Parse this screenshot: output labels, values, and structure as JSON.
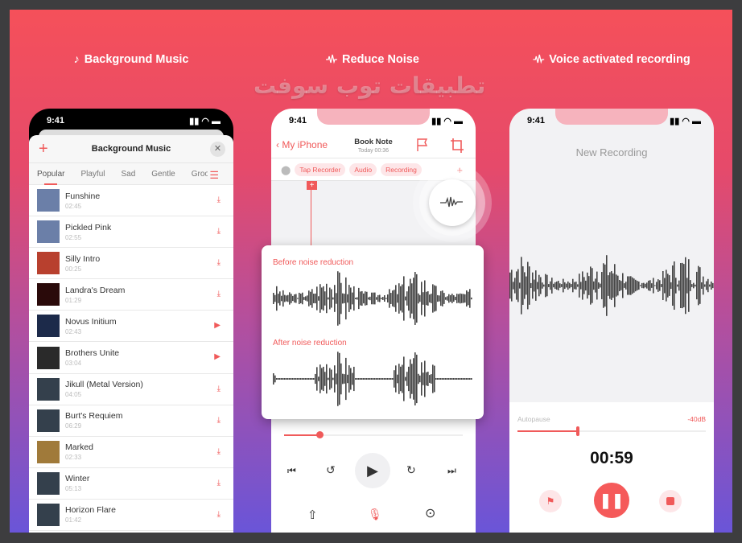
{
  "watermark": "تطبيقات توب سوفت",
  "features": [
    {
      "icon": "music-note-icon",
      "label": "Background Music"
    },
    {
      "icon": "waveform-icon",
      "label": "Reduce Noise"
    },
    {
      "icon": "waveform-icon",
      "label": "Voice activated recording"
    }
  ],
  "colors": {
    "accent": "#f05a5a",
    "bg_top": "#f5505a",
    "bg_bottom": "#6a55d8"
  },
  "status_time": "9:41",
  "music": {
    "title": "Background Music",
    "tabs": [
      "Popular",
      "Playful",
      "Sad",
      "Gentle",
      "Groovi"
    ],
    "tracks": [
      {
        "name": "Funshine",
        "duration": "02:45",
        "action": "download"
      },
      {
        "name": "Pickled Pink",
        "duration": "02:55",
        "action": "download"
      },
      {
        "name": "Silly Intro",
        "duration": "00:25",
        "action": "download"
      },
      {
        "name": "Landra's Dream",
        "duration": "01:29",
        "action": "download"
      },
      {
        "name": "Novus Initium",
        "duration": "02:43",
        "action": "play"
      },
      {
        "name": "Brothers Unite",
        "duration": "03:04",
        "action": "play"
      },
      {
        "name": "Jikull (Metal Version)",
        "duration": "04:05",
        "action": "download"
      },
      {
        "name": "Burt's Requiem",
        "duration": "06:29",
        "action": "download"
      },
      {
        "name": "Marked",
        "duration": "02:33",
        "action": "download"
      },
      {
        "name": "Winter",
        "duration": "05:13",
        "action": "download"
      },
      {
        "name": "Horizon Flare",
        "duration": "01:42",
        "action": "download"
      }
    ]
  },
  "note": {
    "back": "My iPhone",
    "title": "Book Note",
    "subtitle": "Today 00:36",
    "tags": [
      "Tap Recorder",
      "Audio",
      "Recording"
    ],
    "before": "Before noise reduction",
    "after": "After noise reduction",
    "progress": 0.2
  },
  "recorder": {
    "title": "New Recording",
    "autopause": "Autopause",
    "threshold": "-40dB",
    "threshold_level": 0.32,
    "elapsed": "00:59"
  }
}
